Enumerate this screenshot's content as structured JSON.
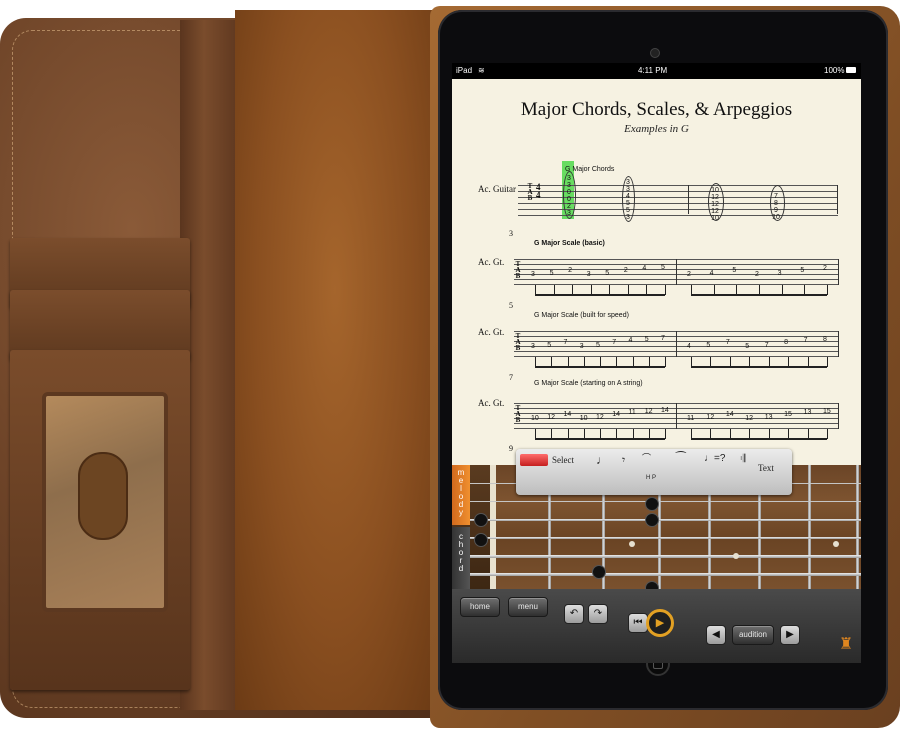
{
  "status_bar": {
    "carrier": "iPad",
    "time": "4:11 PM",
    "battery": "100%"
  },
  "score": {
    "title": "Major Chords, Scales, & Arpeggios",
    "subtitle": "Examples in G",
    "tab_clef": "T A B",
    "time_signature": "4 4",
    "systems": [
      {
        "measure_number": "",
        "instrument": "Ac. Guitar",
        "section_title": "G Major Chords",
        "chords": [
          [
            "3",
            "3",
            "0",
            "0",
            "2",
            "3"
          ],
          [
            "3",
            "3",
            "4",
            "5",
            "5",
            "3"
          ],
          [
            "10",
            "12",
            "12",
            "12",
            "10"
          ],
          [
            "7",
            "8",
            "9",
            "10"
          ]
        ]
      },
      {
        "measure_number": "3",
        "instrument": "Ac. Gt.",
        "section_title": "G Major Scale (basic)",
        "notes_a": [
          "3",
          "5",
          "2",
          "3",
          "5",
          "2",
          "4",
          "5"
        ],
        "notes_b": [
          "2",
          "4",
          "5",
          "2",
          "3",
          "5",
          "2"
        ]
      },
      {
        "measure_number": "5",
        "instrument": "Ac. Gt.",
        "section_title": "G Major Scale (built for speed)",
        "notes_a": [
          "3",
          "5",
          "7",
          "3",
          "5",
          "7",
          "4",
          "5",
          "7"
        ],
        "notes_b": [
          "4",
          "5",
          "7",
          "5",
          "7",
          "8",
          "7",
          "8"
        ]
      },
      {
        "measure_number": "7",
        "instrument": "Ac. Gt.",
        "section_title": "G Major Scale (starting on A string)",
        "notes_a": [
          "10",
          "12",
          "14",
          "10",
          "12",
          "14",
          "11",
          "12",
          "14"
        ],
        "notes_b": [
          "11",
          "12",
          "14",
          "12",
          "13",
          "15",
          "13",
          "15"
        ]
      },
      {
        "measure_number": "9"
      }
    ]
  },
  "palette": {
    "select_label": "Select",
    "hp_label": "H P",
    "text_label": "Text"
  },
  "side_tabs": {
    "melody": "melody",
    "chord": "chord"
  },
  "toolbar": {
    "home_label": "home",
    "menu_label": "menu",
    "audition_label": "audition"
  },
  "colors": {
    "accent_orange": "#e2a023",
    "highlight_green": "#4fd84a",
    "leather": "#6e4428"
  }
}
